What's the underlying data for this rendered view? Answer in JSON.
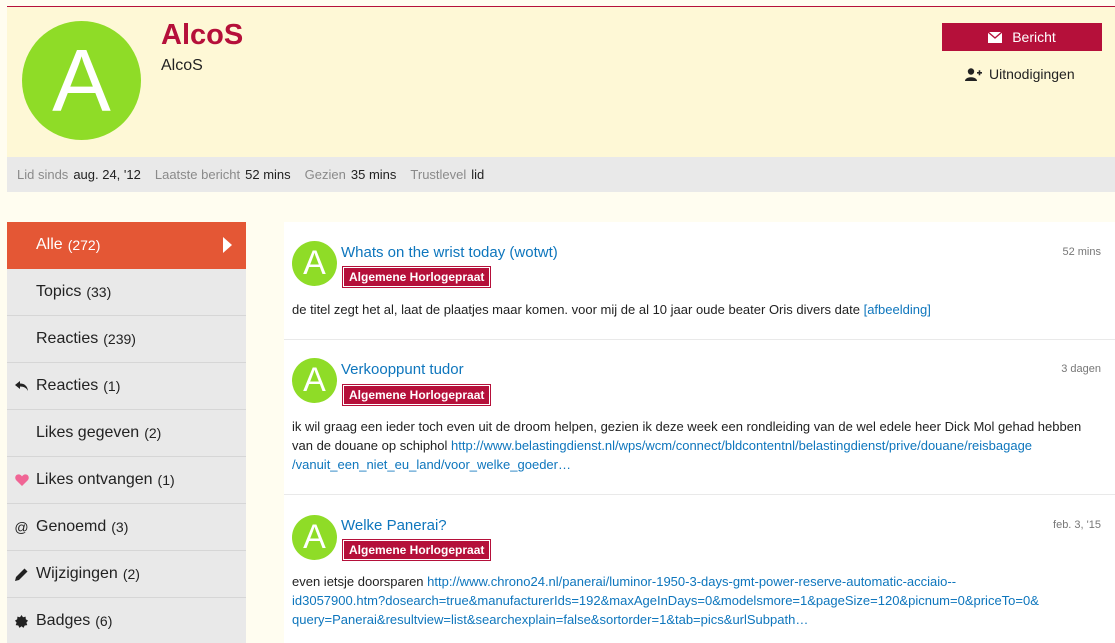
{
  "profile": {
    "avatar_letter": "A",
    "username": "AlcoS",
    "name": "AlcoS",
    "message_button": "Bericht",
    "invites_link": "Uitnodigingen"
  },
  "stats": {
    "member_since_label": "Lid sinds",
    "member_since_value": "aug. 24, '12",
    "last_post_label": "Laatste bericht",
    "last_post_value": "52 mins",
    "seen_label": "Gezien",
    "seen_value": "35 mins",
    "trust_label": "Trustlevel",
    "trust_value": "lid"
  },
  "sidebar": {
    "items": [
      {
        "label": "Alle",
        "count": "(272)",
        "icon": ""
      },
      {
        "label": "Topics",
        "count": "(33)",
        "icon": ""
      },
      {
        "label": "Reacties",
        "count": "(239)",
        "icon": ""
      },
      {
        "label": "Reacties",
        "count": "(1)",
        "icon": "reply-icon"
      },
      {
        "label": "Likes gegeven",
        "count": "(2)",
        "icon": ""
      },
      {
        "label": "Likes ontvangen",
        "count": "(1)",
        "icon": "heart-icon"
      },
      {
        "label": "Genoemd",
        "count": "(3)",
        "icon": "at-icon"
      },
      {
        "label": "Wijzigingen",
        "count": "(2)",
        "icon": "pencil-icon"
      },
      {
        "label": "Badges",
        "count": "(6)",
        "icon": "badge-icon"
      }
    ]
  },
  "posts": [
    {
      "avatar_letter": "A",
      "title": "Whats on the wrist today (wotwt)",
      "time": "52 mins",
      "category": "Algemene Horlogepraat",
      "excerpt_text": "de titel zegt het al, laat de plaatjes maar komen. voor mij de al 10 jaar oude beater Oris divers date ",
      "excerpt_link": "[afbeelding]",
      "excerpt_link2": ""
    },
    {
      "avatar_letter": "A",
      "title": "Verkooppunt tudor",
      "time": "3 dagen",
      "category": "Algemene Horlogepraat",
      "excerpt_text": "ik wil graag een ieder toch even uit de droom helpen, gezien ik deze week een rondleiding van de wel edele heer Dick Mol gehad hebben van de douane op schiphol ",
      "excerpt_link": "http://www.belastingdienst.nl/wps/wcm/connect/bldcontentnl/belastingdienst/prive/douane/reisbagage",
      "excerpt_link2": "/vanuit_een_niet_eu_land/voor_welke_goeder…"
    },
    {
      "avatar_letter": "A",
      "title": "Welke Panerai?",
      "time": "feb. 3, '15",
      "category": "Algemene Horlogepraat",
      "excerpt_text": "even ietsje doorsparen ",
      "excerpt_link": "http://www.chrono24.nl/panerai/luminor-1950-3-days-gmt-power-reserve-automatic-acciaio--",
      "excerpt_link2": "id3057900.htm?dosearch=true&manufacturerIds=192&maxAgeInDays=0&modelsmore=1&pageSize=120&picnum=0&priceTo=0&",
      "excerpt_link3": "query=Panerai&resultview=list&searchexplain=false&sortorder=1&tab=pics&urlSubpath…"
    }
  ],
  "colors": {
    "brand": "#b5103a",
    "active_nav": "#e45735",
    "avatar": "#8fdc27",
    "link": "#0e76bd"
  }
}
